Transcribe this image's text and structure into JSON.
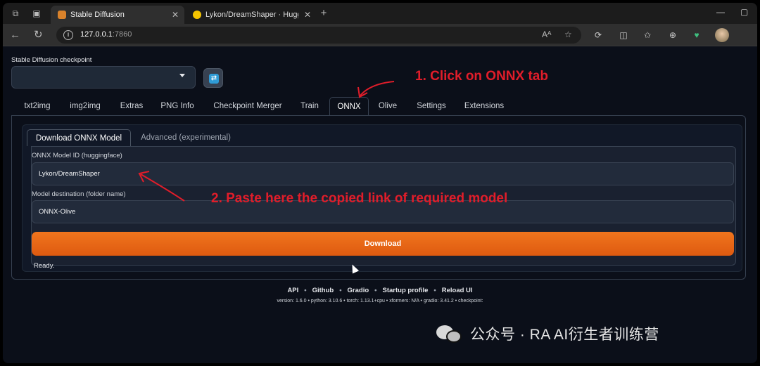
{
  "browser": {
    "tabs": [
      {
        "title": "Stable Diffusion",
        "active": true
      },
      {
        "title": "Lykon/DreamShaper · Hugging F",
        "active": false
      }
    ],
    "new_tab": "+",
    "close_glyph": "✕",
    "url_host": "127.0.0.1",
    "url_port": ":7860",
    "reader_label": "Aᴬ",
    "icons": [
      "workspaces-icon",
      "tab-actions-icon",
      "back-icon",
      "reload-icon",
      "info-icon",
      "read-aloud-icon",
      "favorite-star-icon",
      "refresh-ext-icon",
      "split-screen-icon",
      "favorites-icon",
      "collections-icon",
      "extensions-icon",
      "profile-avatar"
    ]
  },
  "app": {
    "checkpoint_label": "Stable Diffusion checkpoint",
    "checkpoint_value": "",
    "main_tabs": [
      "txt2img",
      "img2img",
      "Extras",
      "PNG Info",
      "Checkpoint Merger",
      "Train",
      "ONNX",
      "Olive",
      "Settings",
      "Extensions"
    ],
    "selected_tab": "ONNX",
    "sub_tabs": [
      "Download ONNX Model",
      "Advanced (experimental)"
    ],
    "selected_sub_tab": "Download ONNX Model",
    "model_id_label": "ONNX Model ID (huggingface)",
    "model_id_value": "Lykon/DreamShaper",
    "dest_label": "Model destination (folder name)",
    "dest_value": "ONNX-Olive",
    "download_label": "Download",
    "status": "Ready.",
    "accent": "#e9661a"
  },
  "footer": {
    "links": [
      "API",
      "Github",
      "Gradio",
      "Startup profile",
      "Reload UI"
    ],
    "separator": "•",
    "versions": "version: 1.6.0  •  python: 3.10.6  •  torch: 1.13.1+cpu  •  xformers: N/A  •  gradio: 3.41.2  •  checkpoint:"
  },
  "annotations": {
    "step1": "1. Click on ONNX tab",
    "step2": "2. Paste here the copied link of required model",
    "color": "#e11d2a"
  },
  "watermark": {
    "text": "公众号 · RA AI衍生者训练营"
  }
}
